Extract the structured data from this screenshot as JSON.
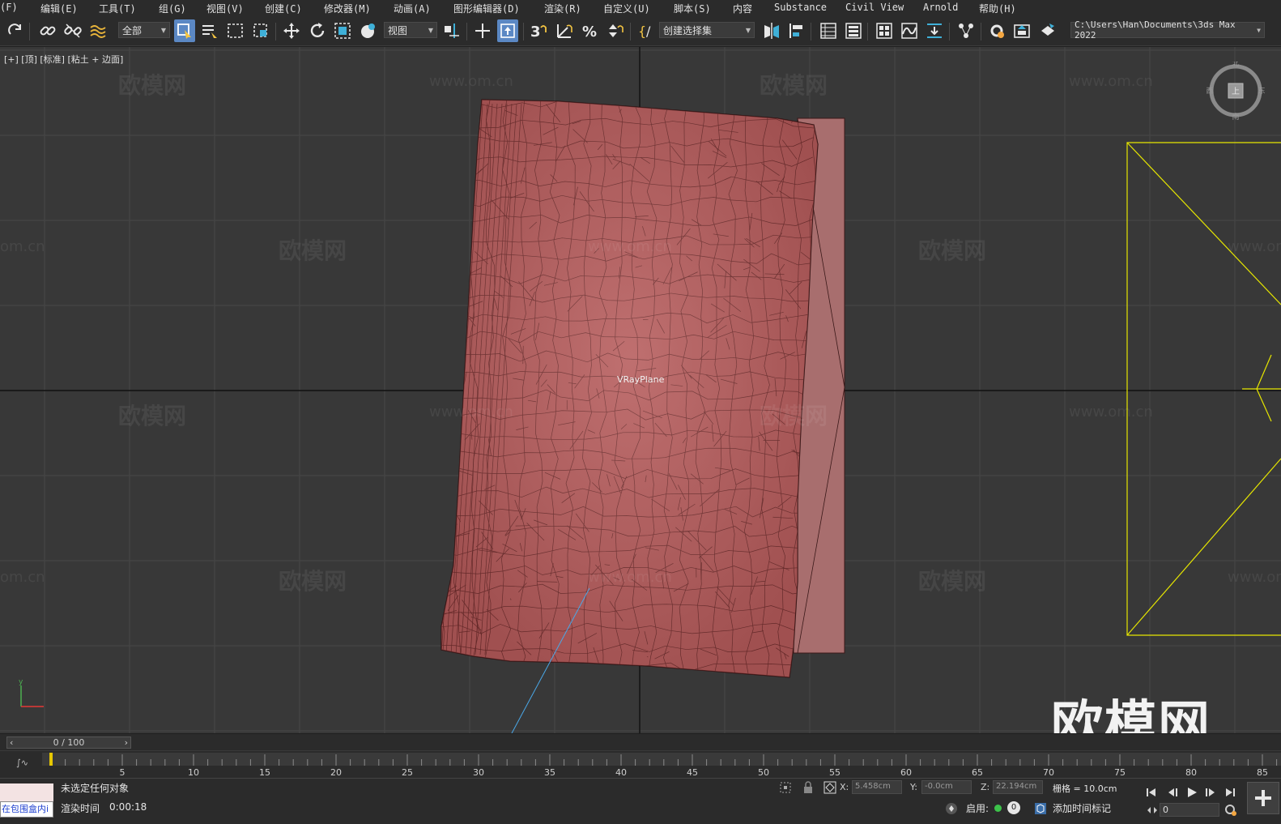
{
  "menu": [
    {
      "label": "(F)"
    },
    {
      "label": "编辑(E)"
    },
    {
      "label": "工具(T)"
    },
    {
      "label": "组(G)"
    },
    {
      "label": "视图(V)"
    },
    {
      "label": "创建(C)"
    },
    {
      "label": "修改器(M)"
    },
    {
      "label": "动画(A)"
    },
    {
      "label": "图形编辑器(D)"
    },
    {
      "label": "渲染(R)"
    },
    {
      "label": "自定义(U)"
    },
    {
      "label": "脚本(S)"
    },
    {
      "label": "内容"
    },
    {
      "label": "Substance"
    },
    {
      "label": "Civil View"
    },
    {
      "label": "Arnold"
    },
    {
      "label": "帮助(H)"
    }
  ],
  "toolbar": {
    "selection_filter": "全部",
    "reference_coord": "视图",
    "named_selection": "创建选择集",
    "project_path": "C:\\Users\\Han\\Documents\\3ds Max 2022",
    "active_color": "#5b88c4"
  },
  "viewport": {
    "label": "[+] [顶] [标准] [粘土 + 边面]",
    "object_name": "VRayPlane",
    "watermark_text": "欧模网",
    "watermark_url": "www.om.cn",
    "watermark_url_partial": "om.cn",
    "logo_text": "欧模网",
    "viewcube": {
      "north": "北",
      "south": "南",
      "east": "东",
      "west": "西",
      "face": "上"
    },
    "mesh_color": "#b96a6a",
    "selection_color": "#e6e600"
  },
  "timeline": {
    "frame_display": "0 / 100",
    "ticks": [
      "5",
      "10",
      "15",
      "20",
      "25",
      "30",
      "35",
      "40",
      "45",
      "50",
      "55",
      "60",
      "65",
      "70",
      "75",
      "80",
      "85"
    ]
  },
  "status": {
    "maxscript_text": "在包围盒内i",
    "selection_text": "未选定任何对象",
    "render_time_label": "渲染时间",
    "render_time_value": "0:00:18",
    "x_label": "X:",
    "x_value": "5.458cm",
    "y_label": "Y:",
    "y_value": "-0.0cm",
    "z_label": "Z:",
    "z_value": "22.194cm",
    "grid_text": "栅格 = 10.0cm",
    "enable_label": "启用:",
    "enable_count": "0",
    "add_time_tag": "添加时间标记",
    "current_frame": "0"
  }
}
